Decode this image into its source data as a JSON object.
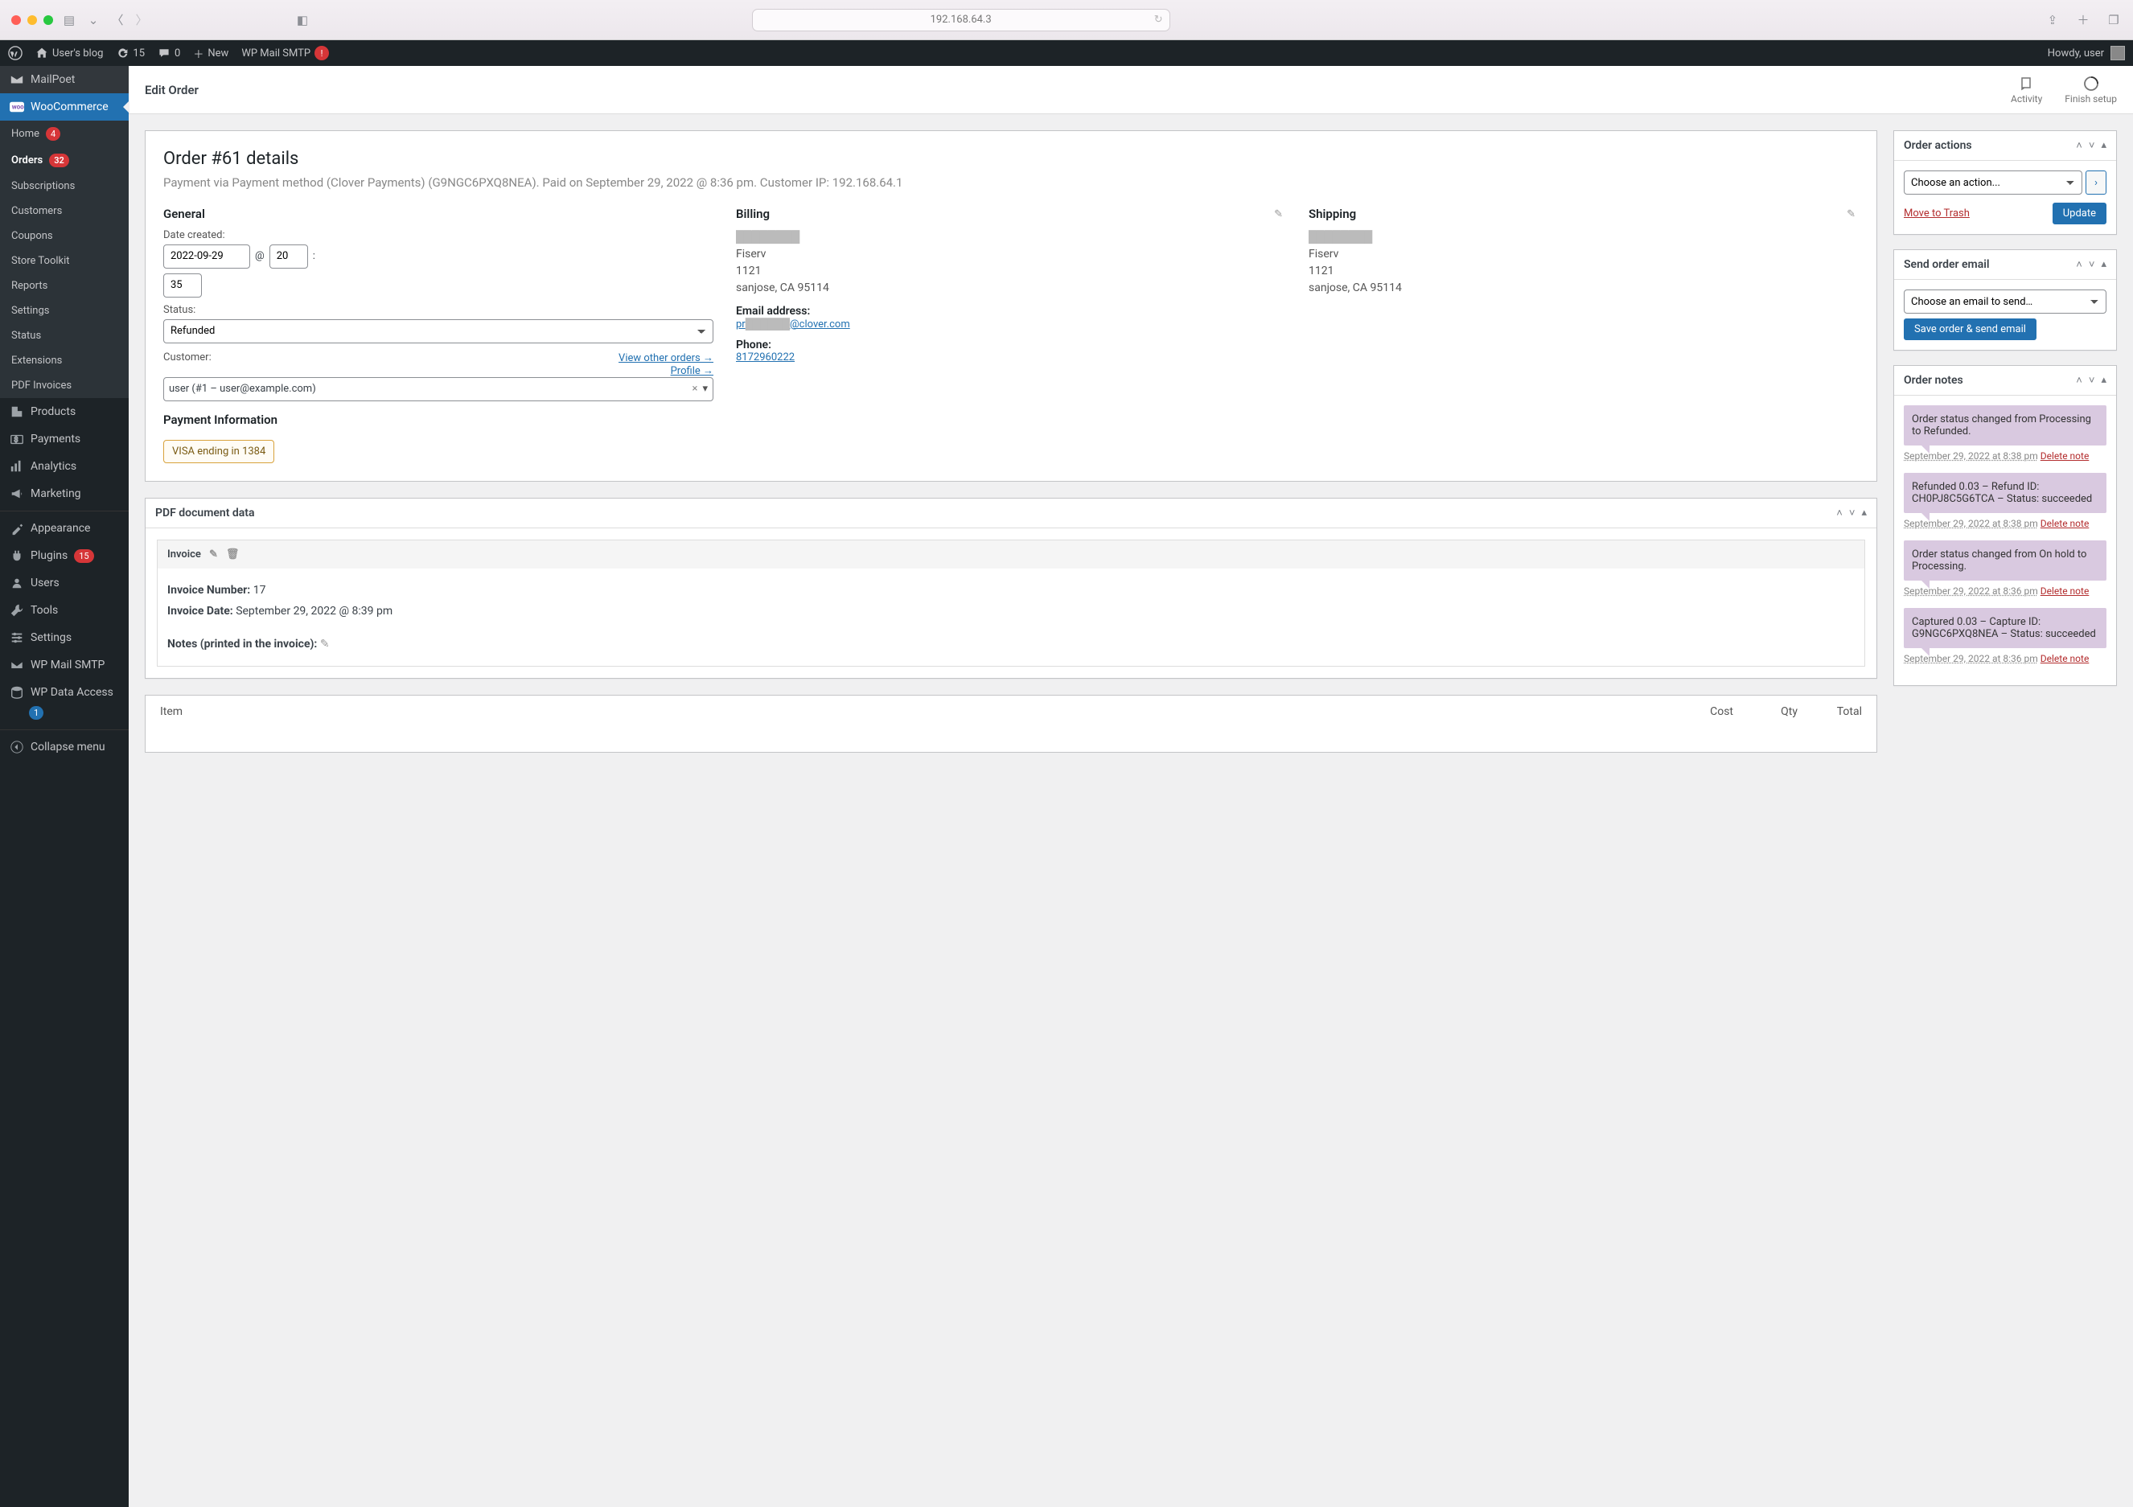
{
  "browser": {
    "url": "192.168.64.3"
  },
  "adminbar": {
    "blog_name": "User's blog",
    "updates": "15",
    "comments": "0",
    "new": "New",
    "wpmail": "WP Mail SMTP",
    "howdy": "Howdy, user"
  },
  "topmenu": {
    "mailpoet": "MailPoet",
    "woocommerce": "WooCommerce"
  },
  "submenu": {
    "home": "Home",
    "home_c": "4",
    "orders": "Orders",
    "orders_c": "32",
    "subs": "Subscriptions",
    "customers": "Customers",
    "coupons": "Coupons",
    "toolkit": "Store Toolkit",
    "reports": "Reports",
    "settings": "Settings",
    "status": "Status",
    "ext": "Extensions",
    "pdf": "PDF Invoices"
  },
  "menu": {
    "products": "Products",
    "payments": "Payments",
    "analytics": "Analytics",
    "marketing": "Marketing",
    "appearance": "Appearance",
    "plugins": "Plugins",
    "plugins_c": "15",
    "users": "Users",
    "tools": "Tools",
    "settings": "Settings",
    "wpmail": "WP Mail SMTP",
    "wpdata": "WP Data Access",
    "wpdata_c": "1",
    "collapse": "Collapse menu"
  },
  "header": {
    "title": "Edit Order",
    "activity": "Activity",
    "finish": "Finish setup"
  },
  "order": {
    "title": "Order #61 details",
    "subtitle": "Payment via Payment method (Clover Payments) (G9NGC6PXQ8NEA). Paid on September 29, 2022 @ 8:36 pm. Customer IP: 192.168.64.1",
    "general": "General",
    "date_label": "Date created:",
    "date": "2022-09-29",
    "at": "@",
    "hour": "20",
    "min": "35",
    "colon": ":",
    "status_label": "Status:",
    "status": "Refunded",
    "customer_label": "Customer:",
    "view_orders": "View other orders →",
    "profile": "Profile →",
    "customer_val": "user (#1 – user@example.com)",
    "pay_info": "Payment Information",
    "card": "VISA ending in 1384",
    "billing": "Billing",
    "shipping": "Shipping",
    "addr_name": "████████",
    "addr_co": "Fiserv",
    "addr_l1": "1121",
    "addr_city": "sanjose, CA 95114",
    "email_label": "Email address:",
    "email_pre": "pr",
    "email_red": "██████",
    "email_post": "@clover.com",
    "phone_label": "Phone:",
    "phone": "8172960222"
  },
  "pdf": {
    "title": "PDF document data",
    "invoice": "Invoice",
    "num_label": "Invoice Number:",
    "num": "17",
    "date_label": "Invoice Date:",
    "date": "September 29, 2022 @ 8:39 pm",
    "notes_label": "Notes (printed in the invoice):"
  },
  "items": {
    "item": "Item",
    "cost": "Cost",
    "qty": "Qty",
    "total": "Total"
  },
  "actions": {
    "title": "Order actions",
    "choose": "Choose an action...",
    "trash": "Move to Trash",
    "update": "Update"
  },
  "email": {
    "title": "Send order email",
    "choose": "Choose an email to send…",
    "save": "Save order & send email"
  },
  "notes": {
    "title": "Order notes",
    "n1": "Order status changed from Processing to Refunded.",
    "n1_meta": "September 29, 2022 at 8:38 pm",
    "n2": "Refunded 0.03 – Refund ID: CH0PJ8C5G6TCA – Status: succeeded",
    "n2_meta": "September 29, 2022 at 8:38 pm",
    "n3": "Order status changed from On hold to Processing.",
    "n3_meta": "September 29, 2022 at 8:36 pm",
    "n4": "Captured 0.03 – Capture ID: G9NGC6PXQ8NEA – Status: succeeded",
    "n4_meta": "September 29, 2022 at 8:36 pm",
    "delete": "Delete note"
  }
}
